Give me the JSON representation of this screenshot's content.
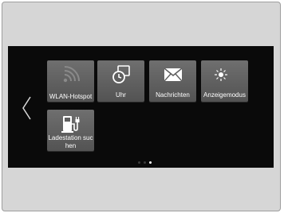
{
  "tiles": [
    {
      "label": "WLAN-Hotspot",
      "icon": "wifi-hotspot-icon"
    },
    {
      "label": "Uhr",
      "icon": "clock-icon"
    },
    {
      "label": "Nachrichten",
      "icon": "envelope-icon"
    },
    {
      "label": "Anzeigemodus",
      "icon": "sun-moon-icon"
    },
    {
      "label": "Ladestation suchen",
      "icon": "charging-station-icon"
    }
  ],
  "pager": {
    "total": 3,
    "active": 3
  },
  "colors": {
    "screen": "#0a0a0a",
    "tile": "#5f5f5f",
    "frame": "#d6d6d6"
  }
}
